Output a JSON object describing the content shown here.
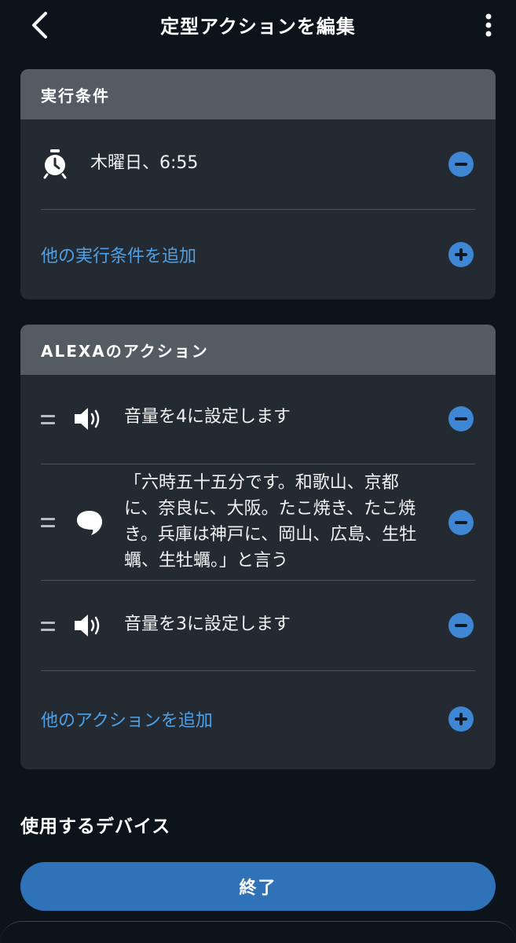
{
  "header": {
    "title": "定型アクションを編集"
  },
  "trigger_card": {
    "title": "実行条件",
    "trigger_text": "木曜日、6:55",
    "add_label": "他の実行条件を追加"
  },
  "actions_card": {
    "title": "ALEXAのアクション",
    "actions": [
      {
        "type": "volume",
        "icon": "speaker-icon",
        "text": "音量を4に設定します"
      },
      {
        "type": "say",
        "icon": "speech-bubble-icon",
        "text": "「六時五十五分です。和歌山、京都に、奈良に、大阪。たこ焼き、たこ焼き。兵庫は神戸に、岡山、広島、生牡蠣、生牡蠣。」と言う"
      },
      {
        "type": "volume",
        "icon": "speaker-icon",
        "text": "音量を3に設定します"
      }
    ],
    "add_label": "他のアクションを追加"
  },
  "devices": {
    "title": "使用するデバイス"
  },
  "finish_button": {
    "label": "終了"
  },
  "colors": {
    "background": "#0c131b",
    "card": "#232a31",
    "card_header": "#545b62",
    "accent": "#3f86d4",
    "link": "#4fa0e6",
    "button": "#2f72b8"
  }
}
